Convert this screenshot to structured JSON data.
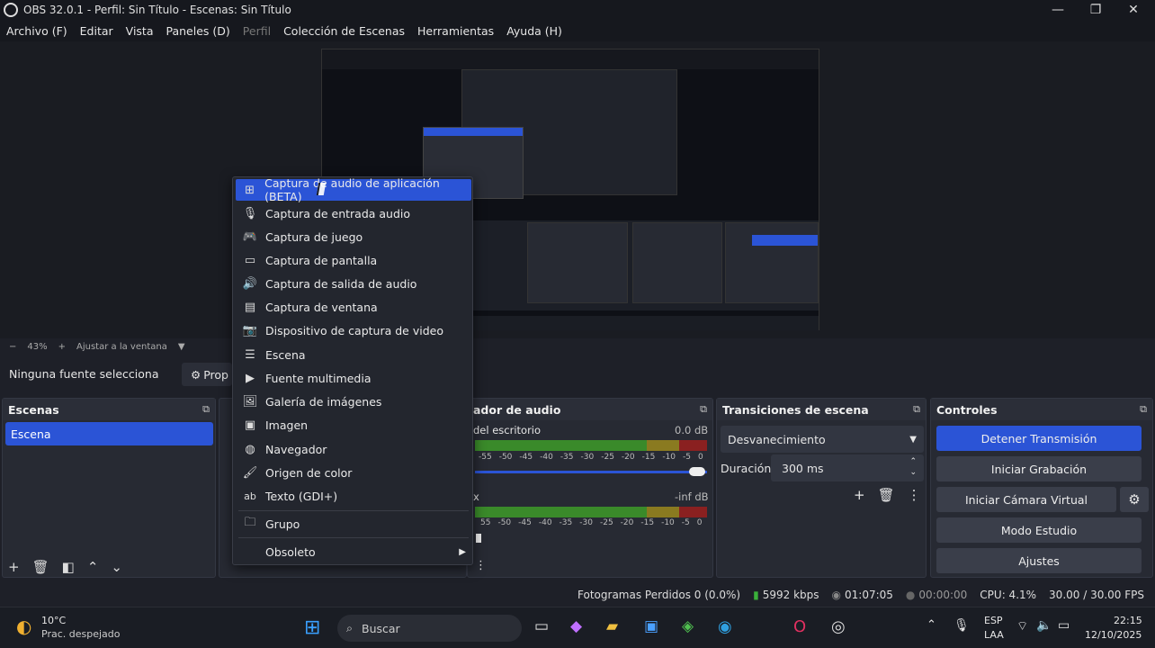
{
  "window": {
    "title": "OBS 32.0.1 - Perfil: Sin Título - Escenas: Sin Título"
  },
  "menubar": {
    "items": [
      "Archivo (F)",
      "Editar",
      "Vista",
      "Paneles (D)",
      "Perfil",
      "Colección de Escenas",
      "Herramientas",
      "Ayuda (H)"
    ]
  },
  "zoombar": {
    "minus": "−",
    "zoom": "43%",
    "plus": "+",
    "fit": "Ajustar a la ventana"
  },
  "sources_bar": {
    "none_selected": "Ninguna fuente selecciona",
    "properties": "Prop"
  },
  "scenes": {
    "title": "Escenas",
    "items": [
      "Escena"
    ]
  },
  "audio_mixer": {
    "title": "ador de audio",
    "channels": [
      {
        "name": "del escritorio",
        "level": "0.0 dB"
      },
      {
        "name": "x",
        "level": "-inf dB"
      }
    ],
    "ticks": [
      "-55",
      "-50",
      "-45",
      "-40",
      "-35",
      "-30",
      "-25",
      "-20",
      "-15",
      "-10",
      "-5",
      "0"
    ],
    "ticks_b": [
      "55",
      "-50",
      "-45",
      "-40",
      "-35",
      "-30",
      "-25",
      "-20",
      "-15",
      "-10",
      "-5",
      "0"
    ]
  },
  "transitions": {
    "title": "Transiciones de escena",
    "selected": "Desvanecimiento",
    "duration_label": "Duración",
    "duration_value": "300 ms"
  },
  "controls": {
    "title": "Controles",
    "buttons": [
      "Detener Transmisión",
      "Iniciar Grabación",
      "Iniciar Cámara Virtual",
      "Modo Estudio",
      "Ajustes"
    ]
  },
  "context_menu": {
    "items": [
      {
        "label": "Captura de audio de aplicación (BETA)",
        "icon": "app-audio-icon",
        "glyph": "⊞"
      },
      {
        "label": "Captura de entrada audio",
        "icon": "microphone-icon",
        "glyph": "🎙"
      },
      {
        "label": "Captura de juego",
        "icon": "gamepad-icon",
        "glyph": "🎮"
      },
      {
        "label": "Captura de pantalla",
        "icon": "monitor-icon",
        "glyph": "▭"
      },
      {
        "label": "Captura de salida de audio",
        "icon": "speaker-icon",
        "glyph": "🔊"
      },
      {
        "label": "Captura de ventana",
        "icon": "window-icon",
        "glyph": "▤"
      },
      {
        "label": "Dispositivo de captura de video",
        "icon": "camera-icon",
        "glyph": "📷"
      },
      {
        "label": "Escena",
        "icon": "list-icon",
        "glyph": "☰"
      },
      {
        "label": "Fuente multimedia",
        "icon": "play-icon",
        "glyph": "▶"
      },
      {
        "label": "Galería de imágenes",
        "icon": "gallery-icon",
        "glyph": "🖼"
      },
      {
        "label": "Imagen",
        "icon": "image-icon",
        "glyph": "▣"
      },
      {
        "label": "Navegador",
        "icon": "globe-icon",
        "glyph": "◍"
      },
      {
        "label": "Origen de color",
        "icon": "brush-icon",
        "glyph": "🖌"
      },
      {
        "label": "Texto (GDI+)",
        "icon": "text-icon",
        "glyph": "ab"
      },
      {
        "label": "Grupo",
        "icon": "folder-icon",
        "glyph": "🗀"
      },
      {
        "label": "Obsoleto",
        "icon": "",
        "glyph": ""
      }
    ],
    "submenu_arrow": "▶"
  },
  "status": {
    "dropped": "Fotogramas Perdidos 0 (0.0%)",
    "bitrate": "5992 kbps",
    "stream_time": "01:07:05",
    "rec_time": "00:00:00",
    "cpu": "CPU: 4.1%",
    "fps": "30.00 / 30.00 FPS"
  },
  "taskbar": {
    "weather_temp": "10°C",
    "weather_desc": "Prac. despejado",
    "search": "Buscar",
    "lang_top": "ESP",
    "lang_bottom": "LAA",
    "time": "22:15",
    "date": "12/10/2025"
  },
  "colors": {
    "accent": "#2b54d6",
    "bg": "#1e2028",
    "dock": "#272a33"
  }
}
